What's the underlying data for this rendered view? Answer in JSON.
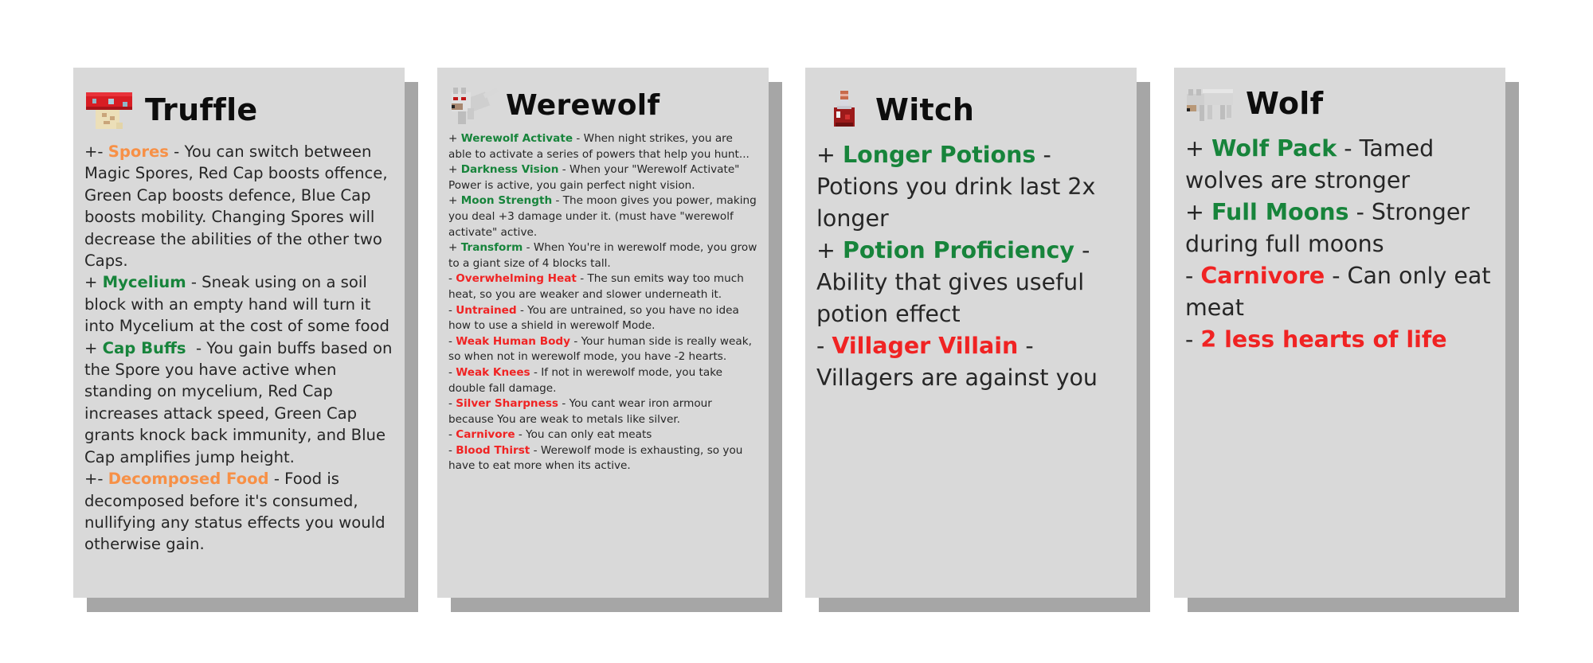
{
  "colors": {
    "positive": "#17843b",
    "negative": "#f02323",
    "mixed": "#f79046",
    "card": "#d9d9d9",
    "shadow": "#a6a6a6"
  },
  "cards": [
    {
      "title": "Truffle",
      "icon": "mushroom-creature-icon",
      "traits": [
        {
          "prefix": "+- ",
          "name": "Spores",
          "kind": "mixed",
          "desc": " - You can switch between Magic Spores, Red Cap boosts offence, Green Cap boosts defence, Blue Cap boosts mobility. Changing Spores will decrease the abilities of the other two Caps."
        },
        {
          "prefix": "+ ",
          "name": "Mycelium",
          "kind": "positive",
          "desc": " - Sneak using on a soil block with an empty hand will turn it into Mycelium at the cost of some food"
        },
        {
          "prefix": "+ ",
          "name": "Cap Buffs",
          "kind": "positive",
          "desc": "  - You gain buffs based on the Spore you have active when standing on mycelium, Red Cap increases attack speed, Green Cap grants knock back immunity, and Blue Cap amplifies jump height."
        },
        {
          "prefix": "+- ",
          "name": "Decomposed Food",
          "kind": "mixed",
          "desc": " - Food is decomposed before it's consumed, nullifying any status effects you would otherwise gain."
        }
      ]
    },
    {
      "title": "Werewolf",
      "icon": "werewolf-icon",
      "traits": [
        {
          "prefix": "+ ",
          "name": "Werewolf Activate",
          "kind": "positive",
          "desc": " - When night strikes, you are able to activate a series of powers that help you hunt..."
        },
        {
          "prefix": "+ ",
          "name": "Darkness Vision",
          "kind": "positive",
          "desc": " - When your \"Werewolf Activate\" Power is active, you gain perfect night vision."
        },
        {
          "prefix": "+ ",
          "name": "Moon Strength",
          "kind": "positive",
          "desc": " - The moon gives you power, making you deal +3 damage under it. (must have \"werewolf activate\" active."
        },
        {
          "prefix": "+ ",
          "name": "Transform",
          "kind": "positive",
          "desc": " - When You're in werewolf mode, you grow to a giant size of 4 blocks tall."
        },
        {
          "prefix": "- ",
          "name": "Overwhelming Heat",
          "kind": "negative",
          "desc": " - The sun emits way too much heat, so you are weaker and slower underneath it."
        },
        {
          "prefix": "- ",
          "name": "Untrained",
          "kind": "negative",
          "desc": " - You are untrained, so you have no idea how to use a shield in werewolf Mode."
        },
        {
          "prefix": "- ",
          "name": "Weak Human Body",
          "kind": "negative",
          "desc": " - Your human side is really weak, so when not in werewolf mode, you have -2 hearts."
        },
        {
          "prefix": "- ",
          "name": "Weak Knees",
          "kind": "negative",
          "desc": " - If not in werewolf mode, you take double fall damage."
        },
        {
          "prefix": "- ",
          "name": "Silver Sharpness",
          "kind": "negative",
          "desc": " - You cant wear iron armour because You are weak to metals like silver."
        },
        {
          "prefix": "- ",
          "name": "Carnivore",
          "kind": "negative",
          "desc": " - You can only eat meats"
        },
        {
          "prefix": "- ",
          "name": "Blood Thirst",
          "kind": "negative",
          "desc": " - Werewolf mode is exhausting, so you have to eat more when its active."
        }
      ]
    },
    {
      "title": "Witch",
      "icon": "potion-bottle-icon",
      "traits": [
        {
          "prefix": "+ ",
          "name": "Longer Potions",
          "kind": "positive",
          "desc": " - Potions you drink last 2x longer"
        },
        {
          "prefix": "+ ",
          "name": "Potion Proficiency",
          "kind": "positive",
          "desc": " - Ability that gives useful potion effect"
        },
        {
          "prefix": "- ",
          "name": "Villager Villain",
          "kind": "negative",
          "desc": " - Villagers are against you"
        }
      ]
    },
    {
      "title": "Wolf",
      "icon": "wolf-icon",
      "traits": [
        {
          "prefix": "+ ",
          "name": "Wolf Pack",
          "kind": "positive",
          "desc": " - Tamed wolves are stronger"
        },
        {
          "prefix": "+ ",
          "name": "Full Moons",
          "kind": "positive",
          "desc": " - Stronger during full moons"
        },
        {
          "prefix": "- ",
          "name": "Carnivore",
          "kind": "negative",
          "desc": " - Can only eat meat"
        },
        {
          "prefix": "- ",
          "name": "2 less hearts of life",
          "kind": "negative",
          "desc": ""
        }
      ]
    }
  ]
}
